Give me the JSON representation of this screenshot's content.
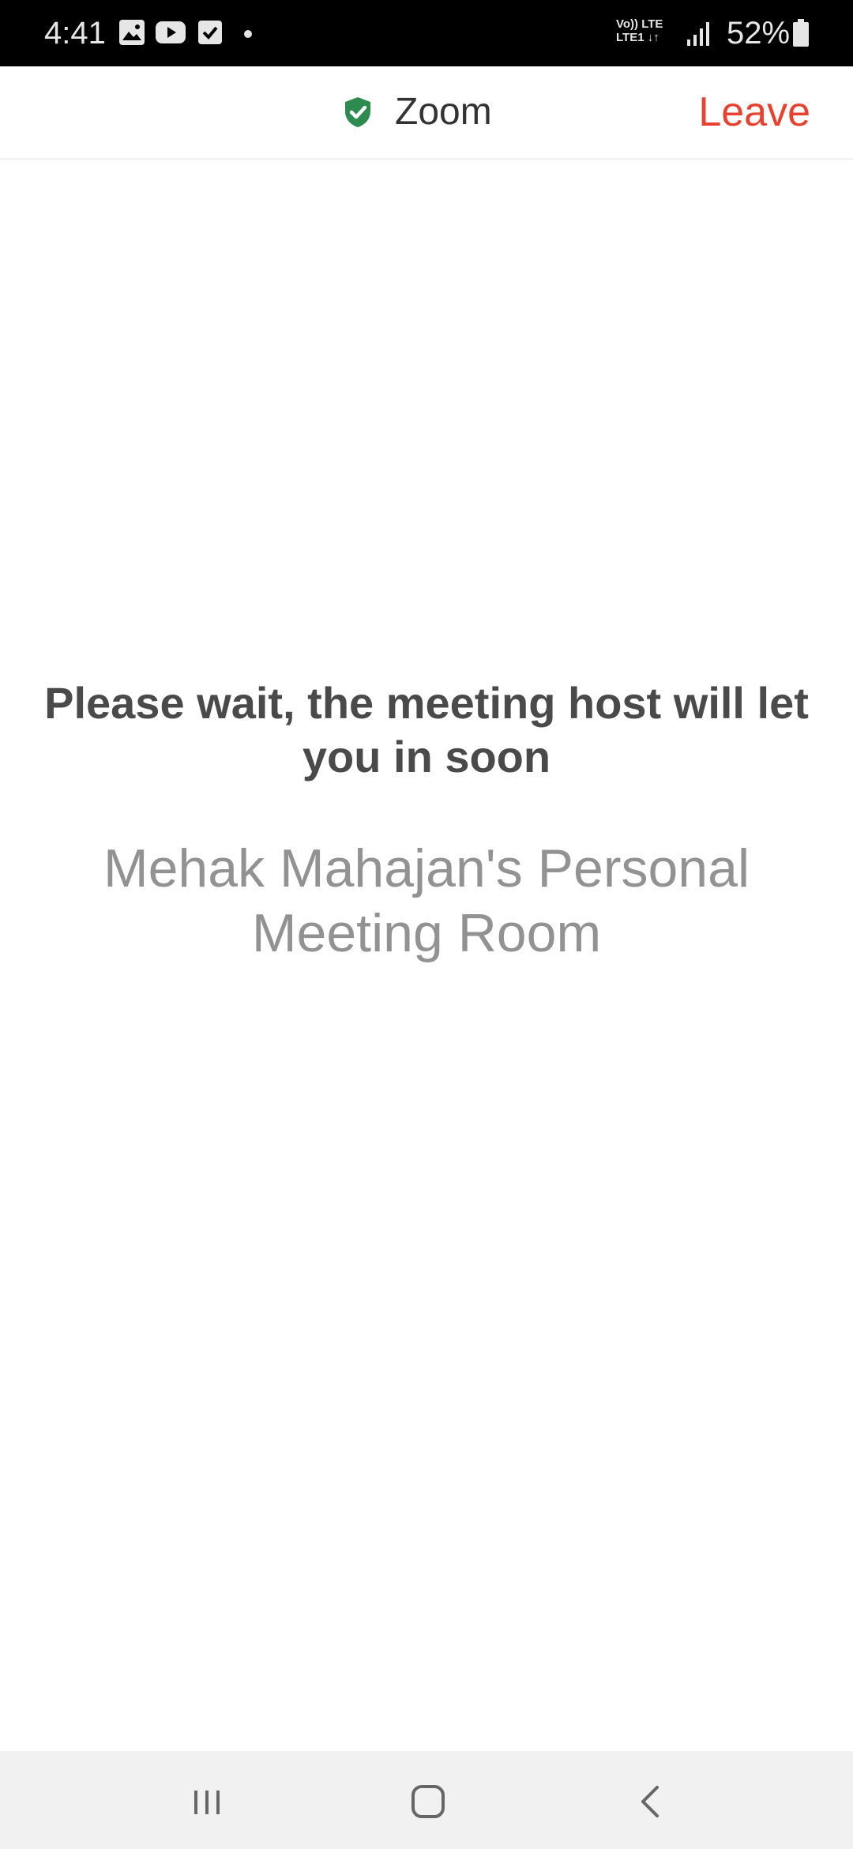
{
  "status_bar": {
    "time": "4:41",
    "battery_percent": "52%",
    "network_label_line1": "Vo)) LTE",
    "network_label_line2": "LTE1 ↓↑",
    "notification_icons": [
      "gallery-icon",
      "youtube-icon",
      "checkbox-icon"
    ],
    "signal_icon": "signal-bars-icon",
    "battery_icon": "battery-icon"
  },
  "header": {
    "title": "Zoom",
    "security_icon": "shield-check-icon",
    "security_color": "#2e8b4f",
    "leave_label": "Leave",
    "leave_color": "#e8412f"
  },
  "main": {
    "wait_message": "Please wait, the meeting host will let you in soon",
    "room_name": "Mehak Mahajan's Personal Meeting Room"
  },
  "nav_bar": {
    "items": [
      "recent-apps-icon",
      "home-icon",
      "back-icon"
    ]
  }
}
